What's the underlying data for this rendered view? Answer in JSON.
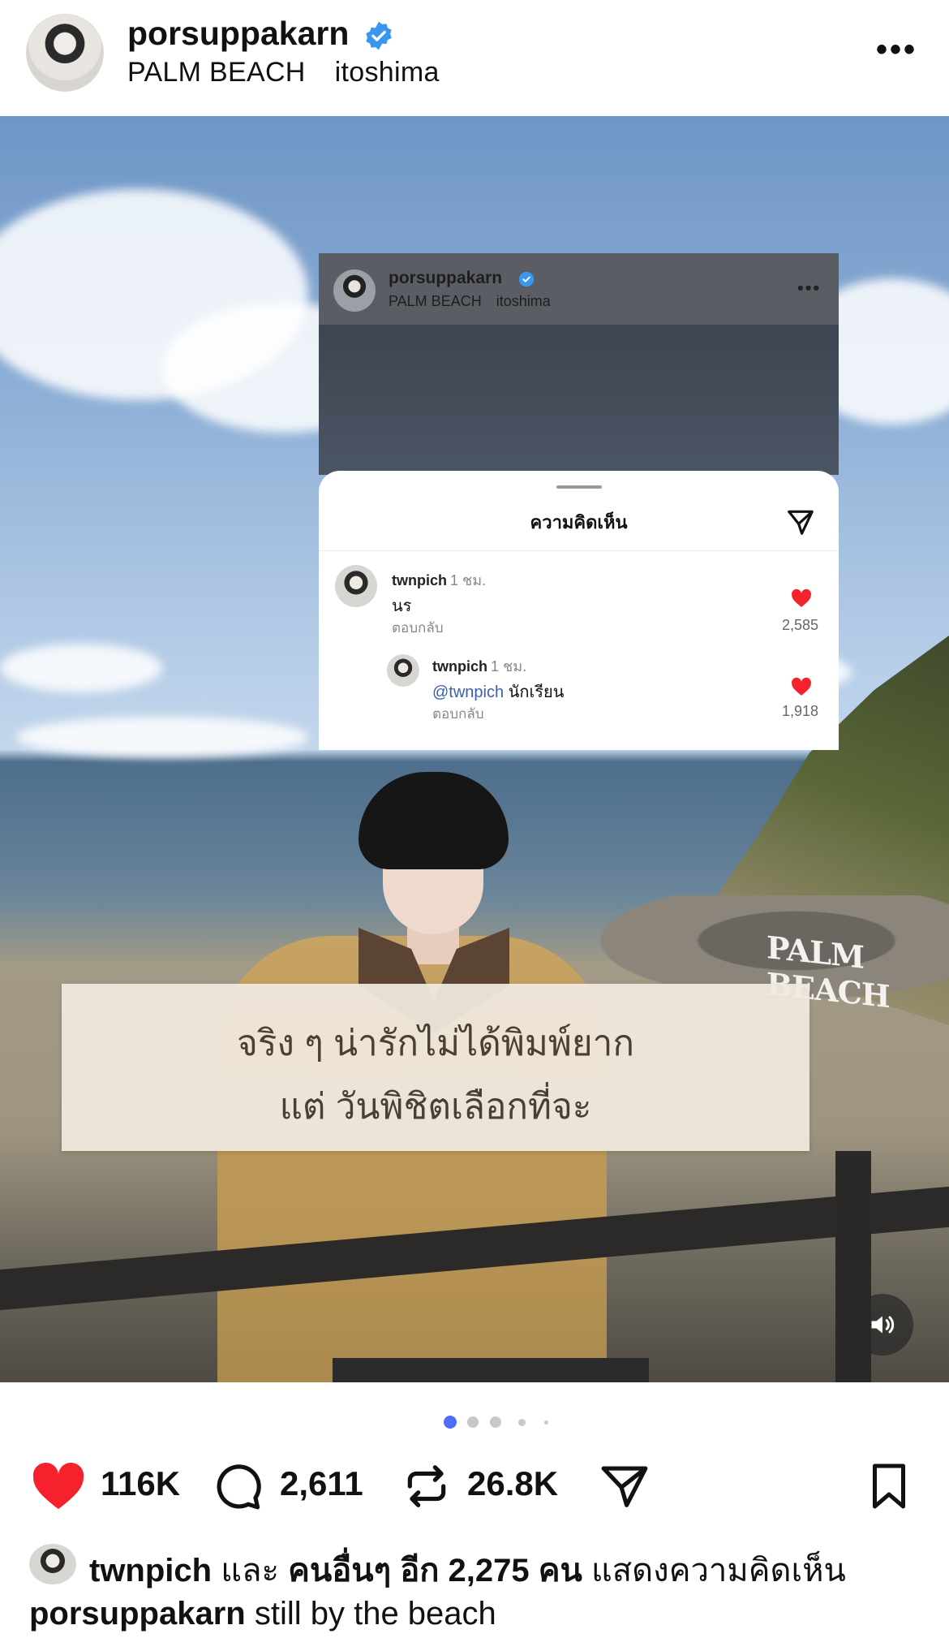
{
  "header": {
    "username": "porsuppakarn",
    "locations": [
      "PALM BEACH",
      "itoshima"
    ],
    "more": "•••"
  },
  "photo": {
    "sign_text": "PALM BEACH",
    "overlay_lines": [
      "จริง ๆ น่ารักไม่ได้พิมพ์ยาก",
      "แต่ วันพิชิตเลือกที่จะ"
    ]
  },
  "embed": {
    "username": "porsuppakarn",
    "locations": [
      "PALM BEACH",
      "itoshima"
    ],
    "more": "•••",
    "sheet_title": "ความคิดเห็น",
    "comments": [
      {
        "user": "twnpich",
        "time": "1 ชม.",
        "text": "นร",
        "reply": "ตอบกลับ",
        "likes": "2,585"
      },
      {
        "user": "twnpich",
        "time": "1 ชม.",
        "mention": "@twnpich",
        "text": "นักเรียน",
        "reply": "ตอบกลับ",
        "likes": "1,918"
      }
    ]
  },
  "actions": {
    "likes": "116K",
    "comments": "2,611",
    "reposts": "26.8K"
  },
  "liked_by": {
    "user": "twnpich",
    "and": "และ",
    "others": "คนอื่นๆ อีก 2,275 คน",
    "suffix": "แสดงความคิดเห็น"
  },
  "caption": {
    "user": "porsuppakarn",
    "text": "still by the beach"
  },
  "colors": {
    "heart": "#f5222d",
    "verified": "#3897f0",
    "active_dot": "#4f6ef7"
  },
  "carousel": {
    "active_index": 0,
    "count": 5
  }
}
